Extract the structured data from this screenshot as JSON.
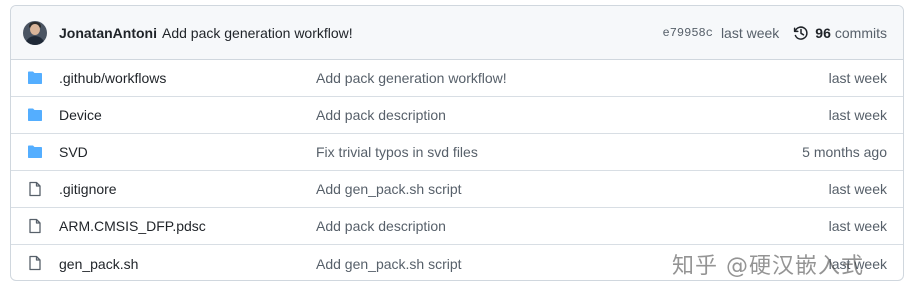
{
  "latest_commit": {
    "author": "JonatanAntoni",
    "message": "Add pack generation workflow!",
    "sha": "e79958c",
    "time": "last week",
    "commits_count": "96",
    "commits_label": "commits"
  },
  "files": [
    {
      "type": "folder",
      "name": ".github/workflows",
      "message": "Add pack generation workflow!",
      "age": "last week"
    },
    {
      "type": "folder",
      "name": "Device",
      "message": "Add pack description",
      "age": "last week"
    },
    {
      "type": "folder",
      "name": "SVD",
      "message": "Fix trivial typos in svd files",
      "age": "5 months ago"
    },
    {
      "type": "file",
      "name": ".gitignore",
      "message": "Add gen_pack.sh script",
      "age": "last week"
    },
    {
      "type": "file",
      "name": "ARM.CMSIS_DFP.pdsc",
      "message": "Add pack description",
      "age": "last week"
    },
    {
      "type": "file",
      "name": "gen_pack.sh",
      "message": "Add gen_pack.sh script",
      "age": "last week"
    }
  ],
  "watermark": "知乎 @硬汉嵌入式",
  "colors": {
    "folder_icon": "#54aeff",
    "file_icon": "#57606a",
    "header_bg": "#f6f8fa"
  }
}
